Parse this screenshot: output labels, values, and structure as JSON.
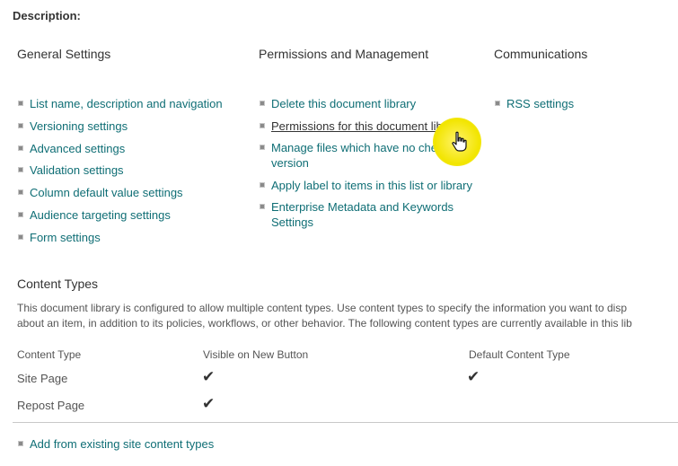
{
  "description_label": "Description:",
  "columns": [
    {
      "heading": "General Settings",
      "links": [
        "List name, description and navigation",
        "Versioning settings",
        "Advanced settings",
        "Validation settings",
        "Column default value settings",
        "Audience targeting settings",
        "Form settings"
      ]
    },
    {
      "heading": "Permissions and Management",
      "links": [
        "Delete this document library",
        "Permissions for this document library",
        "Manage files which have no checked in version",
        "Apply label to items in this list or library",
        "Enterprise Metadata and Keywords Settings"
      ]
    },
    {
      "heading": "Communications",
      "links": [
        "RSS settings"
      ]
    }
  ],
  "content_types": {
    "title": "Content Types",
    "description": [
      "This document library is configured to allow multiple content types. Use content types to specify the information you want to disp",
      "about an item, in addition to its policies, workflows, or other behavior. The following content types are currently available in this lib"
    ],
    "headers": [
      "Content Type",
      "Visible on New Button",
      "Default Content Type"
    ],
    "rows": [
      {
        "name": "Site Page",
        "visible": true,
        "default": true
      },
      {
        "name": "Repost Page",
        "visible": true,
        "default": false
      }
    ],
    "check_glyph": "✔",
    "actions": [
      "Add from existing site content types"
    ]
  },
  "colors": {
    "link": "#0f6e75",
    "text": "#333333",
    "highlight": "#f2e500"
  }
}
